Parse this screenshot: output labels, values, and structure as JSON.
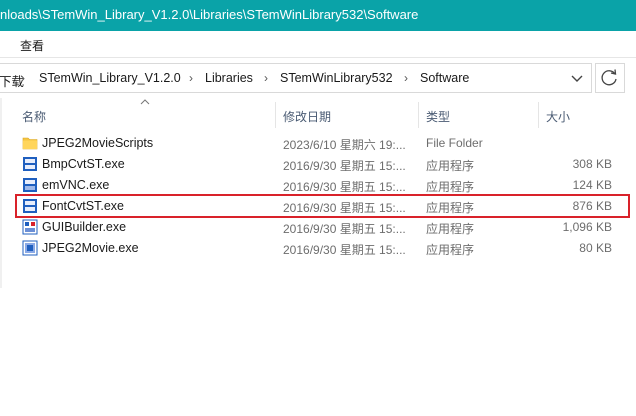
{
  "window": {
    "title": "nloads\\STemWin_Library_V1.2.0\\Libraries\\STemWinLibrary532\\Software"
  },
  "ribbon": {
    "view_menu": "查看"
  },
  "address": {
    "crumbs": [
      "下载",
      "STemWin_Library_V1.2.0",
      "Libraries",
      "STemWinLibrary532",
      "Software"
    ],
    "separator": "›"
  },
  "columns": {
    "name": "名称",
    "date": "修改日期",
    "type": "类型",
    "size": "大小"
  },
  "files": [
    {
      "name": "JPEG2MovieScripts",
      "date": "2023/6/10 星期六 19:...",
      "type": "File Folder",
      "size": "",
      "icon": "folder-icon"
    },
    {
      "name": "BmpCvtST.exe",
      "date": "2016/9/30 星期五 15:...",
      "type": "应用程序",
      "size": "308 KB",
      "icon": "bmpcvt-app-icon"
    },
    {
      "name": "emVNC.exe",
      "date": "2016/9/30 星期五 15:...",
      "type": "应用程序",
      "size": "124 KB",
      "icon": "emvnc-app-icon"
    },
    {
      "name": "FontCvtST.exe",
      "date": "2016/9/30 星期五 15:...",
      "type": "应用程序",
      "size": "876 KB",
      "icon": "fontcvt-app-icon"
    },
    {
      "name": "GUIBuilder.exe",
      "date": "2016/9/30 星期五 15:...",
      "type": "应用程序",
      "size": "1,096 KB",
      "icon": "guibuilder-app-icon"
    },
    {
      "name": "JPEG2Movie.exe",
      "date": "2016/9/30 星期五 15:...",
      "type": "应用程序",
      "size": "80 KB",
      "icon": "jpeg2movie-app-icon"
    }
  ],
  "highlighted_file": "FontCvtST.exe",
  "colors": {
    "titlebar": "#0aa3a8",
    "highlight_border": "#d9222a",
    "folder": "#f5c542",
    "app_icon": "#1f5fbf"
  }
}
